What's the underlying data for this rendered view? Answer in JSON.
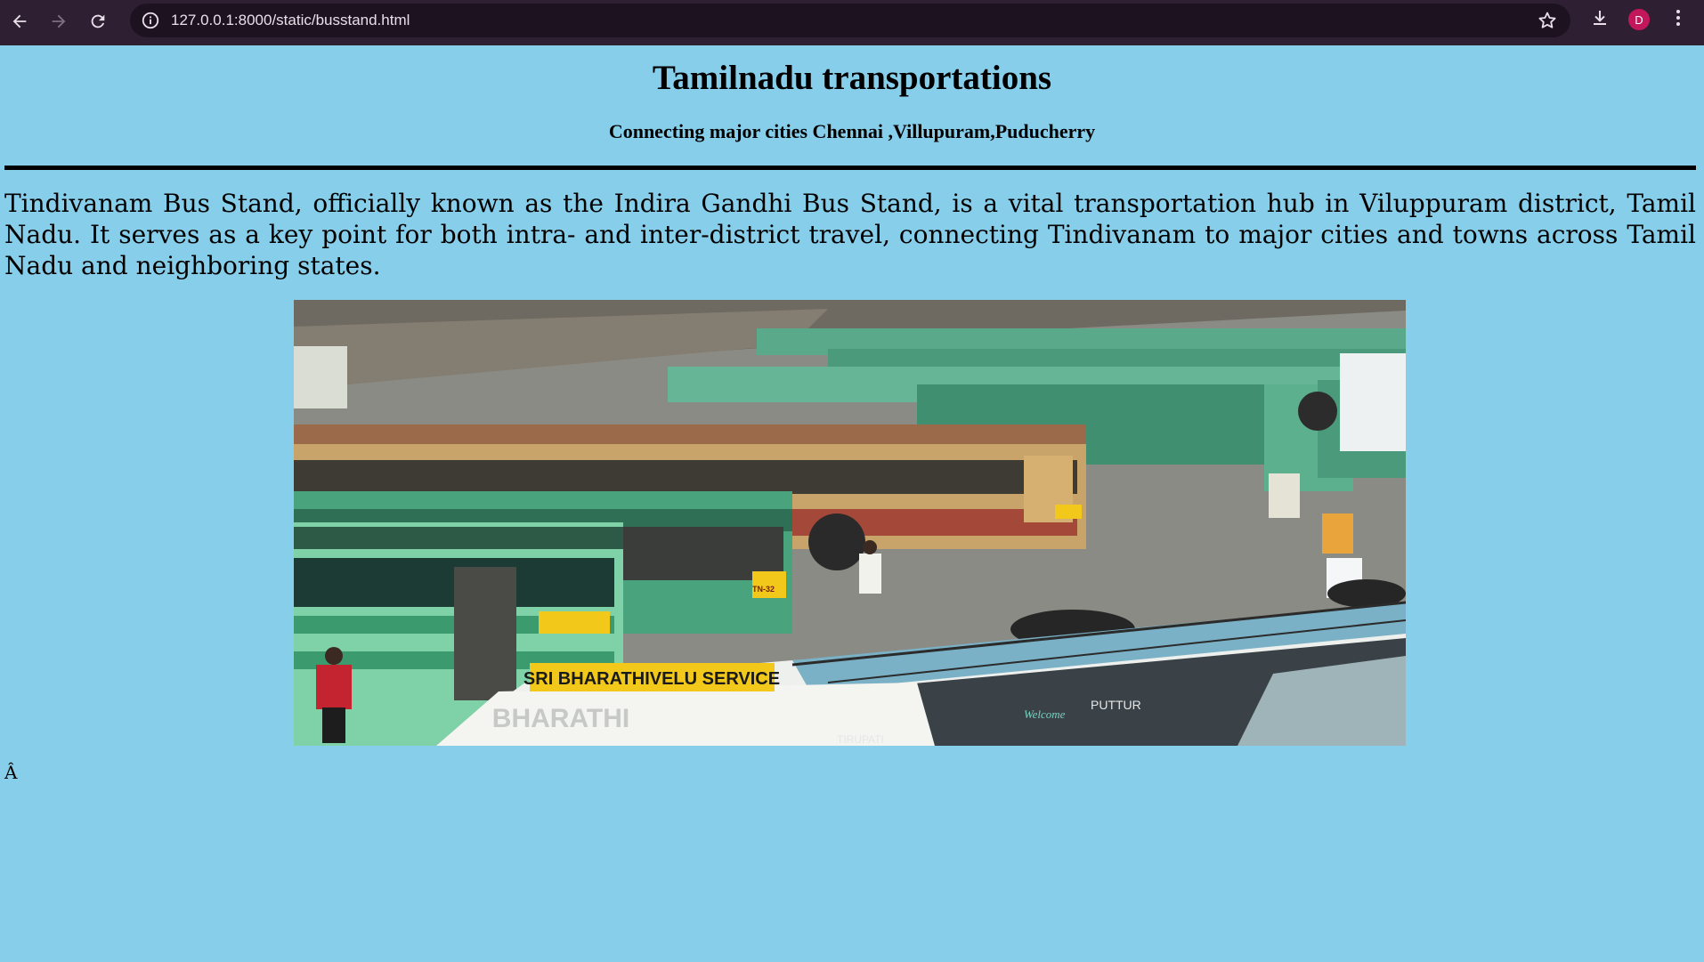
{
  "browser": {
    "url": "127.0.0.1:8000/static/busstand.html",
    "avatar_letter": "D",
    "icons": {
      "back": "arrow-left-icon",
      "forward": "arrow-right-icon",
      "reload": "reload-icon",
      "site_info": "info-icon",
      "bookmark": "star-icon",
      "downloads": "download-icon",
      "menu": "kebab-menu-icon"
    }
  },
  "page": {
    "title": "Tamilnadu transportations",
    "subtitle": "Connecting major cities Chennai ,Villupuram,Puducherry",
    "intro": "Tindivanam Bus Stand, officially known as the Indira Gandhi Bus Stand, is a vital transportation hub in Viluppuram district, Tamil Nadu. It serves as a key point for both intra- and inter-district travel, connecting Tindivanam to major cities and towns across Tamil Nadu and neighboring states.",
    "stray_char": "Â",
    "background_color": "#87ceeb",
    "photo": {
      "sign_text": "SRI BHARATHIVELU SERVICE",
      "bus_side_text": "BHARATHI",
      "plate_text": "TN-32",
      "route_text_1": "PUTTUR",
      "route_text_2": "TIRUPATI",
      "route_text_3": "Welcome"
    }
  }
}
